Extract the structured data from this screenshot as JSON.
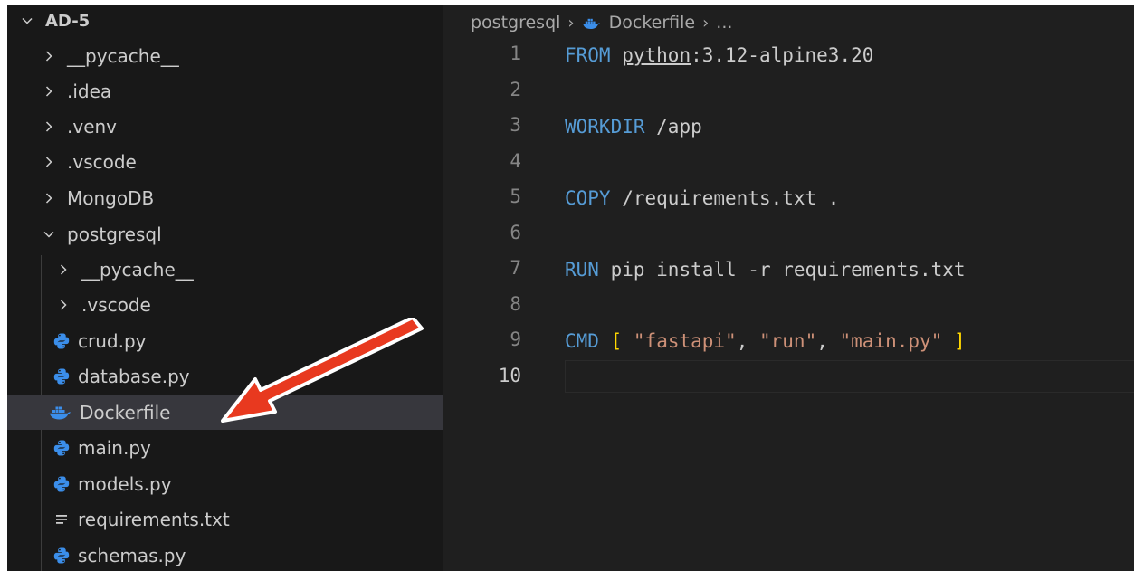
{
  "explorer": {
    "root": "AD-5",
    "items": [
      {
        "label": "__pycache__",
        "type": "folder",
        "expanded": false
      },
      {
        "label": ".idea",
        "type": "folder",
        "expanded": false
      },
      {
        "label": ".venv",
        "type": "folder",
        "expanded": false
      },
      {
        "label": ".vscode",
        "type": "folder",
        "expanded": false
      },
      {
        "label": "MongoDB",
        "type": "folder",
        "expanded": false
      },
      {
        "label": "postgresql",
        "type": "folder",
        "expanded": true
      },
      {
        "label": "__pycache__",
        "type": "folder",
        "expanded": false
      },
      {
        "label": ".vscode",
        "type": "folder",
        "expanded": false
      },
      {
        "label": "crud.py",
        "type": "python-file"
      },
      {
        "label": "database.py",
        "type": "python-file"
      },
      {
        "label": "Dockerfile",
        "type": "docker-file",
        "selected": true
      },
      {
        "label": "main.py",
        "type": "python-file"
      },
      {
        "label": "models.py",
        "type": "python-file"
      },
      {
        "label": "requirements.txt",
        "type": "text-file"
      },
      {
        "label": "schemas.py",
        "type": "python-file"
      }
    ]
  },
  "breadcrumb": {
    "folder": "postgresql",
    "file": "Dockerfile",
    "more": "..."
  },
  "editor": {
    "active_line": 10,
    "line_numbers": [
      "1",
      "2",
      "3",
      "4",
      "5",
      "6",
      "7",
      "8",
      "9",
      "10"
    ],
    "code": {
      "l1_kw": "FROM",
      "l1_image": "python",
      "l1_tag": ":3.12-alpine3.20",
      "l3_kw": "WORKDIR",
      "l3_arg": " /app",
      "l5_kw": "COPY",
      "l5_arg": " /requirements.txt .",
      "l7_kw": "RUN",
      "l7_arg": " pip install -r requirements.txt",
      "l9_kw": "CMD",
      "l9_open": "[",
      "l9_s1": "\"fastapi\"",
      "l9_c1": ", ",
      "l9_s2": "\"run\"",
      "l9_c2": ", ",
      "l9_s3": "\"main.py\"",
      "l9_close": "]"
    }
  },
  "colors": {
    "sidebar_bg": "#181818",
    "editor_bg": "#1f1f1f",
    "selection_bg": "#37373d",
    "keyword": "#569cd6",
    "string": "#ce9178",
    "bracket": "#ffd700",
    "python_icon": "#3b8eea",
    "docker_icon": "#3b8eea",
    "annotation_arrow": "#e8391f"
  },
  "annotation": {
    "shape": "arrow",
    "points_to": "Dockerfile"
  }
}
